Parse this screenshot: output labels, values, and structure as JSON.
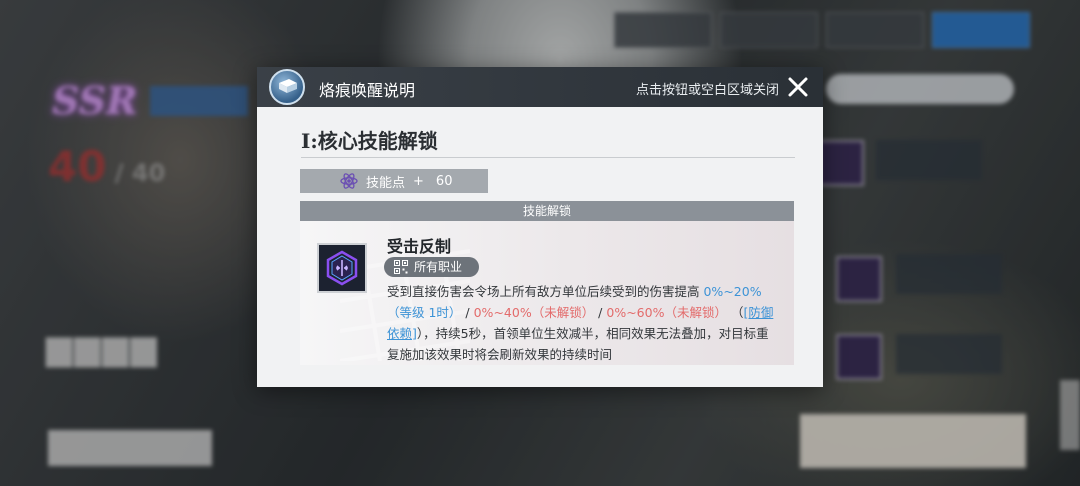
{
  "modal": {
    "title": "烙痕唤醒说明",
    "close_hint": "点击按钮或空白区域关闭",
    "section_title": "I:核心技能解锁",
    "points": {
      "label": "技能点",
      "plus": "+",
      "value": "60"
    },
    "unlock_header": "技能解锁",
    "skill": {
      "name": "受击反制",
      "class_tag": "所有职业",
      "description": {
        "p1": "受到直接伤害会令场上所有敌方单位后续受到的伤害提高 ",
        "v1": "0%~20%（等级 1时）",
        "sep1": " / ",
        "v2": "0%~40%（未解锁）",
        "sep2": " / ",
        "v3": "0%~60%（未解锁）",
        "p2_open": " （",
        "link": "[防御依赖]",
        "p2_close": "），持续5秒，首领单位生效减半，相同效果无法叠加，对目标重复施加该效果时将会刷新效果的持续时间"
      }
    }
  },
  "colors": {
    "value_blue": "#3d93d6",
    "value_red": "#e36b6b",
    "header_dark": "#2a3036"
  }
}
